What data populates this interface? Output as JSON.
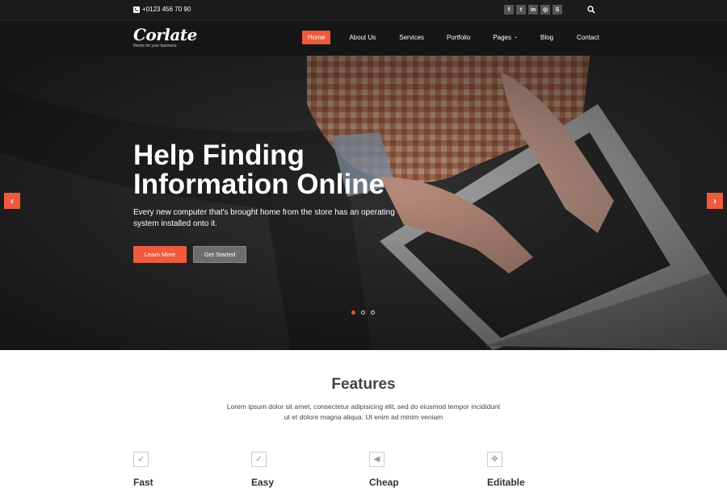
{
  "topbar": {
    "phone": "+0123 456 70 90",
    "socials": [
      {
        "icon": "facebook-icon",
        "glyph": "f"
      },
      {
        "icon": "twitter-icon",
        "glyph": "t"
      },
      {
        "icon": "linkedin-icon",
        "glyph": "in"
      },
      {
        "icon": "dribbble-icon",
        "glyph": "◎"
      },
      {
        "icon": "skype-icon",
        "glyph": "S"
      }
    ]
  },
  "logo": {
    "name": "Corlate",
    "tagline": "theme for your business"
  },
  "nav": [
    {
      "label": "Home",
      "active": true
    },
    {
      "label": "About Us"
    },
    {
      "label": "Services"
    },
    {
      "label": "Portfolio"
    },
    {
      "label": "Pages",
      "dropdown": true
    },
    {
      "label": "Blog"
    },
    {
      "label": "Contact"
    }
  ],
  "hero": {
    "title": "Help Finding Information Online",
    "subtitle": "Every new computer that's brought home from the store has an operating system installed onto it.",
    "learn_more": "Learn More",
    "get_started": "Get Started",
    "active_slide": 1,
    "slide_count": 3
  },
  "features": {
    "title": "Features",
    "description": "Lorem ipsum dolor sit amet, consectetur adipisicing elit, sed do eiusmod tempor incididunt ut et dolore magna aliqua. Ut enim ad minim veniam",
    "items": [
      {
        "name": "Fast",
        "icon": "rocket-icon",
        "glyph": "➶"
      },
      {
        "name": "Easy",
        "icon": "check-icon",
        "glyph": "✓"
      },
      {
        "name": "Cheap",
        "icon": "bullhorn-icon",
        "glyph": "◀"
      },
      {
        "name": "Editable",
        "icon": "arrows-move-icon",
        "glyph": "✥"
      }
    ]
  },
  "colors": {
    "accent": "#ef5a3d",
    "topbar": "#1b1b1b",
    "navbar": "#161616"
  }
}
